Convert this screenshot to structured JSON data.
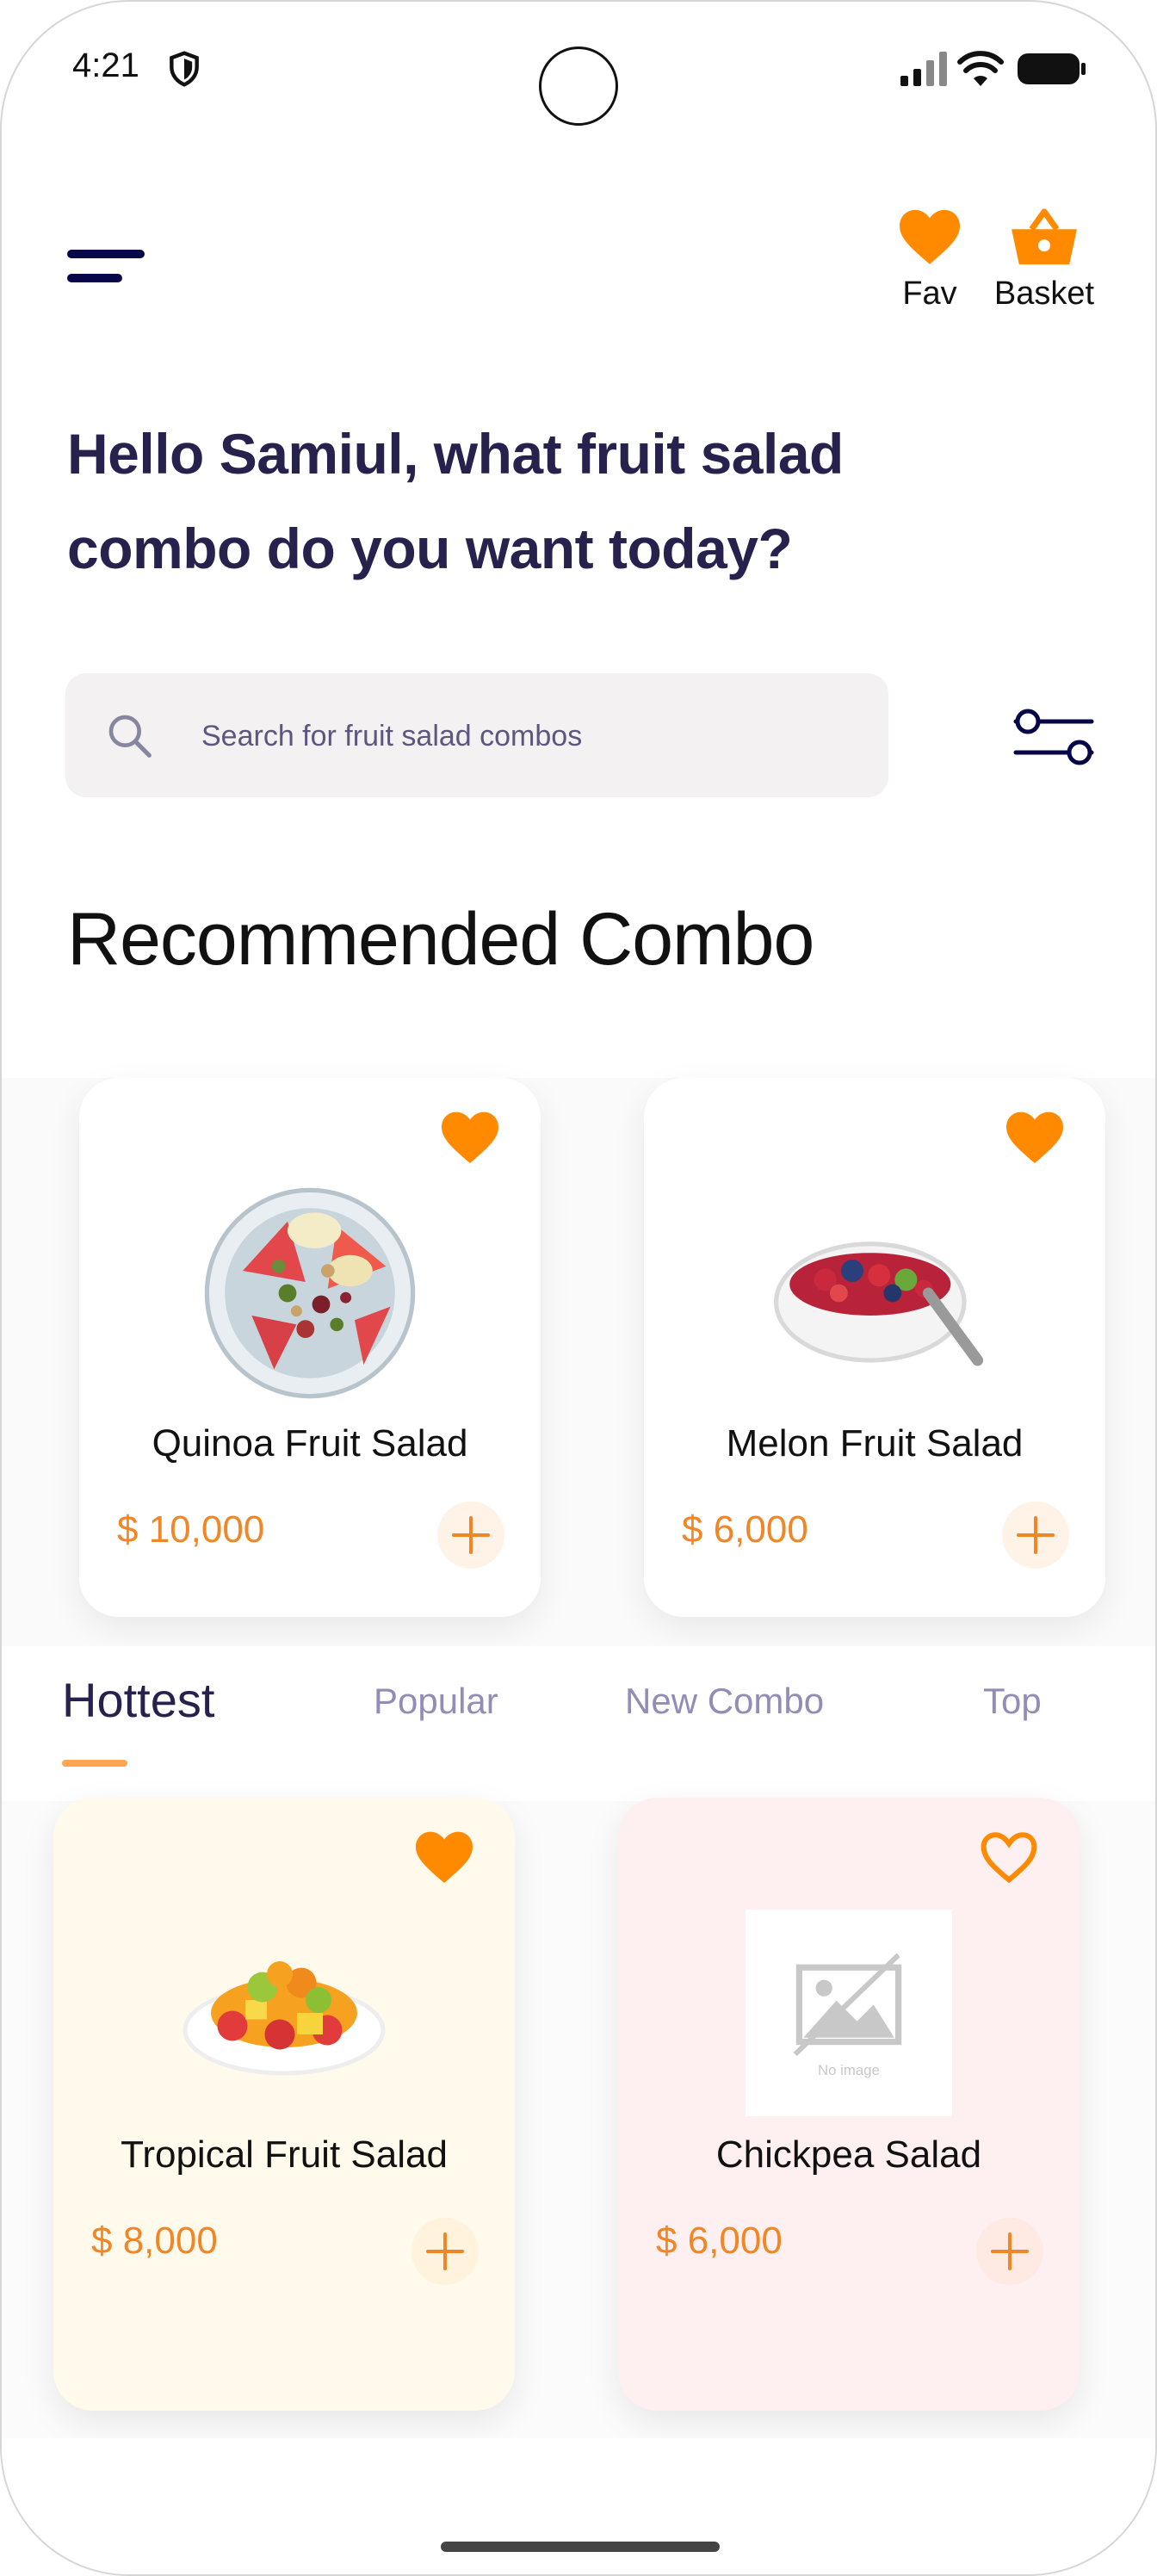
{
  "status_bar": {
    "time": "4:21"
  },
  "header": {
    "fav_label": "Fav",
    "basket_label": "Basket"
  },
  "greeting": {
    "line1": "Hello Samiul, what fruit salad",
    "line2": "combo do you want today?"
  },
  "search": {
    "placeholder": "Search for fruit salad combos"
  },
  "recommended": {
    "title": "Recommended Combo",
    "items": [
      {
        "name": "Quinoa Fruit Salad",
        "price": "$ 10,000",
        "favorited": true
      },
      {
        "name": "Melon Fruit Salad",
        "price": "$ 6,000",
        "favorited": true
      }
    ]
  },
  "tabs": [
    {
      "label": "Hottest",
      "active": true
    },
    {
      "label": "Popular",
      "active": false
    },
    {
      "label": "New Combo",
      "active": false
    },
    {
      "label": "Top",
      "active": false
    }
  ],
  "hottest": {
    "items": [
      {
        "name": "Tropical Fruit Salad",
        "price": "$ 8,000",
        "favorited": true,
        "bg": "#FFFAEB"
      },
      {
        "name": "Chickpea Salad",
        "price": "$ 6,000",
        "favorited": false,
        "bg": "#FEF0F0",
        "image_placeholder": "No image"
      }
    ]
  },
  "colors": {
    "accent": "#FFA451",
    "price": "#F08626",
    "heading": "#27214D",
    "heart": "#FF8A00"
  }
}
